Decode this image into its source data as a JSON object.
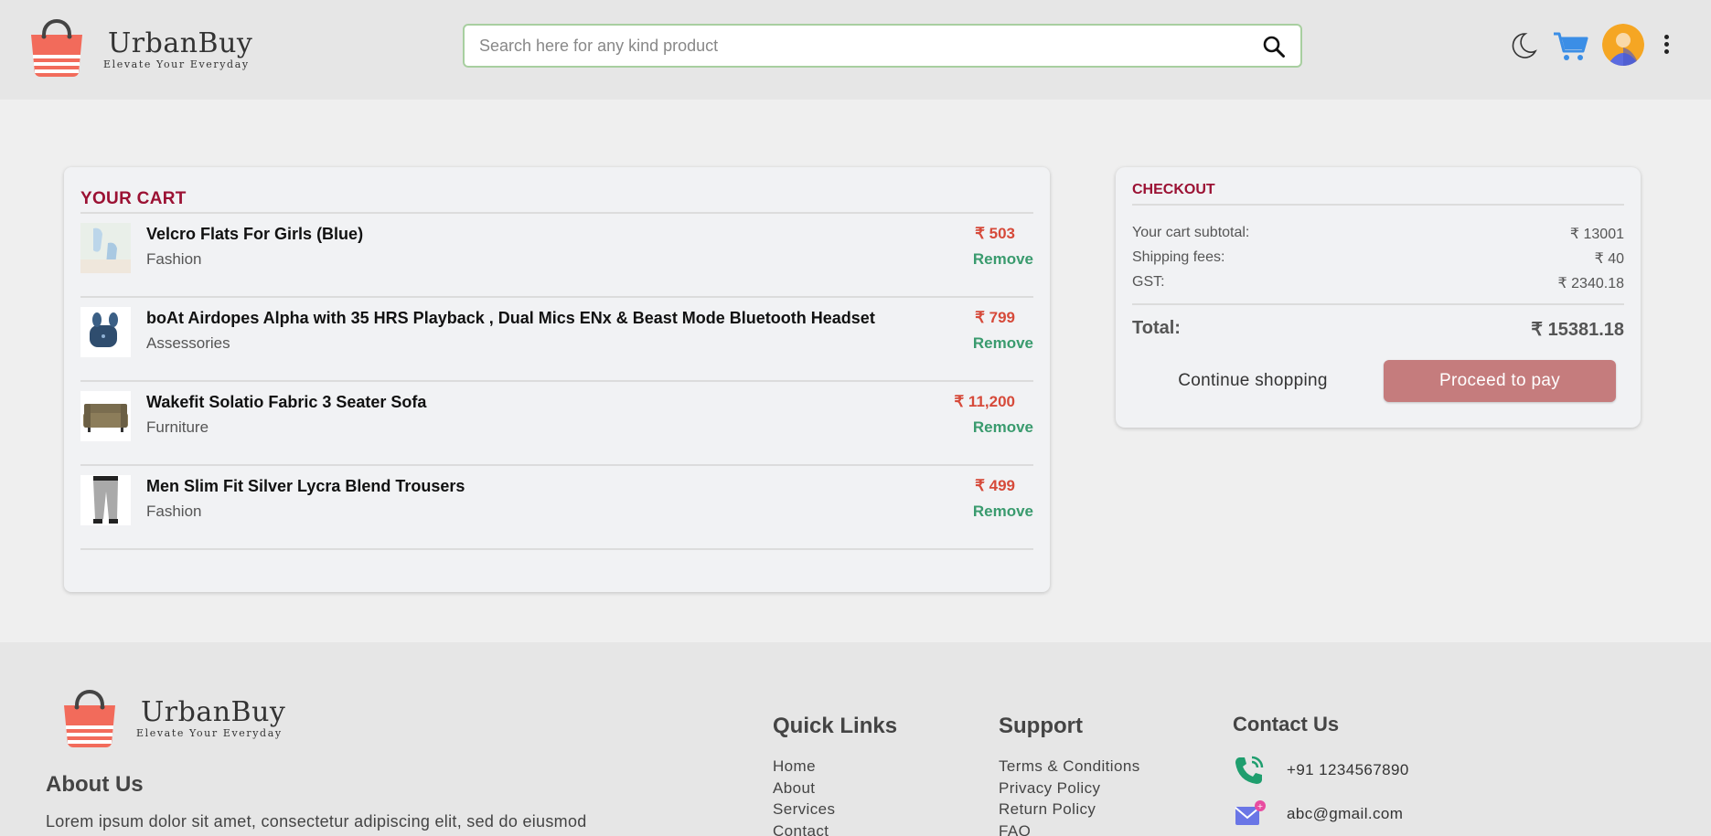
{
  "header": {
    "brand_name": "UrbanBuy",
    "brand_tagline": "Elevate Your Everyday",
    "search_placeholder": "Search here for any kind product",
    "icons": [
      "bag-logo-icon",
      "search-icon",
      "moon-icon",
      "cart-icon",
      "avatar",
      "kebab-menu-icon"
    ]
  },
  "cart": {
    "title": "YOUR CART",
    "items": [
      {
        "name": "Velcro Flats For Girls (Blue)",
        "category": "Fashion",
        "price": "₹ 503",
        "remove": "Remove"
      },
      {
        "name": "boAt Airdopes Alpha with 35 HRS Playback , Dual Mics ENx & Beast Mode Bluetooth Headset",
        "category": "Assessories",
        "price": "₹ 799",
        "remove": "Remove"
      },
      {
        "name": "Wakefit Solatio Fabric 3 Seater Sofa",
        "category": "Furniture",
        "price": "₹ 11,200",
        "remove": "Remove"
      },
      {
        "name": "Men Slim Fit Silver Lycra Blend Trousers",
        "category": "Fashion",
        "price": "₹ 499",
        "remove": "Remove"
      }
    ]
  },
  "checkout": {
    "title": "CHECKOUT",
    "subtotal_label": "Your cart subtotal:",
    "subtotal_value": "₹ 13001",
    "shipping_label": "Shipping fees:",
    "shipping_value": "₹ 40",
    "gst_label": "GST:",
    "gst_value": "₹ 2340.18",
    "total_label": "Total:",
    "total_value": "₹ 15381.18",
    "continue_label": "Continue shopping",
    "pay_label": "Proceed to pay"
  },
  "footer": {
    "brand_name": "UrbanBuy",
    "brand_tagline": "Elevate Your Everyday",
    "about_heading": "About Us",
    "about_text": "Lorem ipsum dolor sit amet, consectetur adipiscing elit, sed do eiusmod",
    "quick_links": {
      "heading": "Quick Links",
      "links": [
        "Home",
        "About",
        "Services",
        "Contact"
      ]
    },
    "support": {
      "heading": "Support",
      "links": [
        "Terms & Conditions",
        "Privacy Policy",
        "Return Policy",
        "FAQ"
      ]
    },
    "contact": {
      "heading": "Contact Us",
      "phone": "+91 1234567890",
      "email": "abc@gmail.com"
    }
  },
  "colors": {
    "accent": "#9b1133",
    "price": "#d64a3a",
    "remove": "#3a9b6e",
    "pay_button": "#c57c7d",
    "search_border": "#a8cfa0"
  }
}
